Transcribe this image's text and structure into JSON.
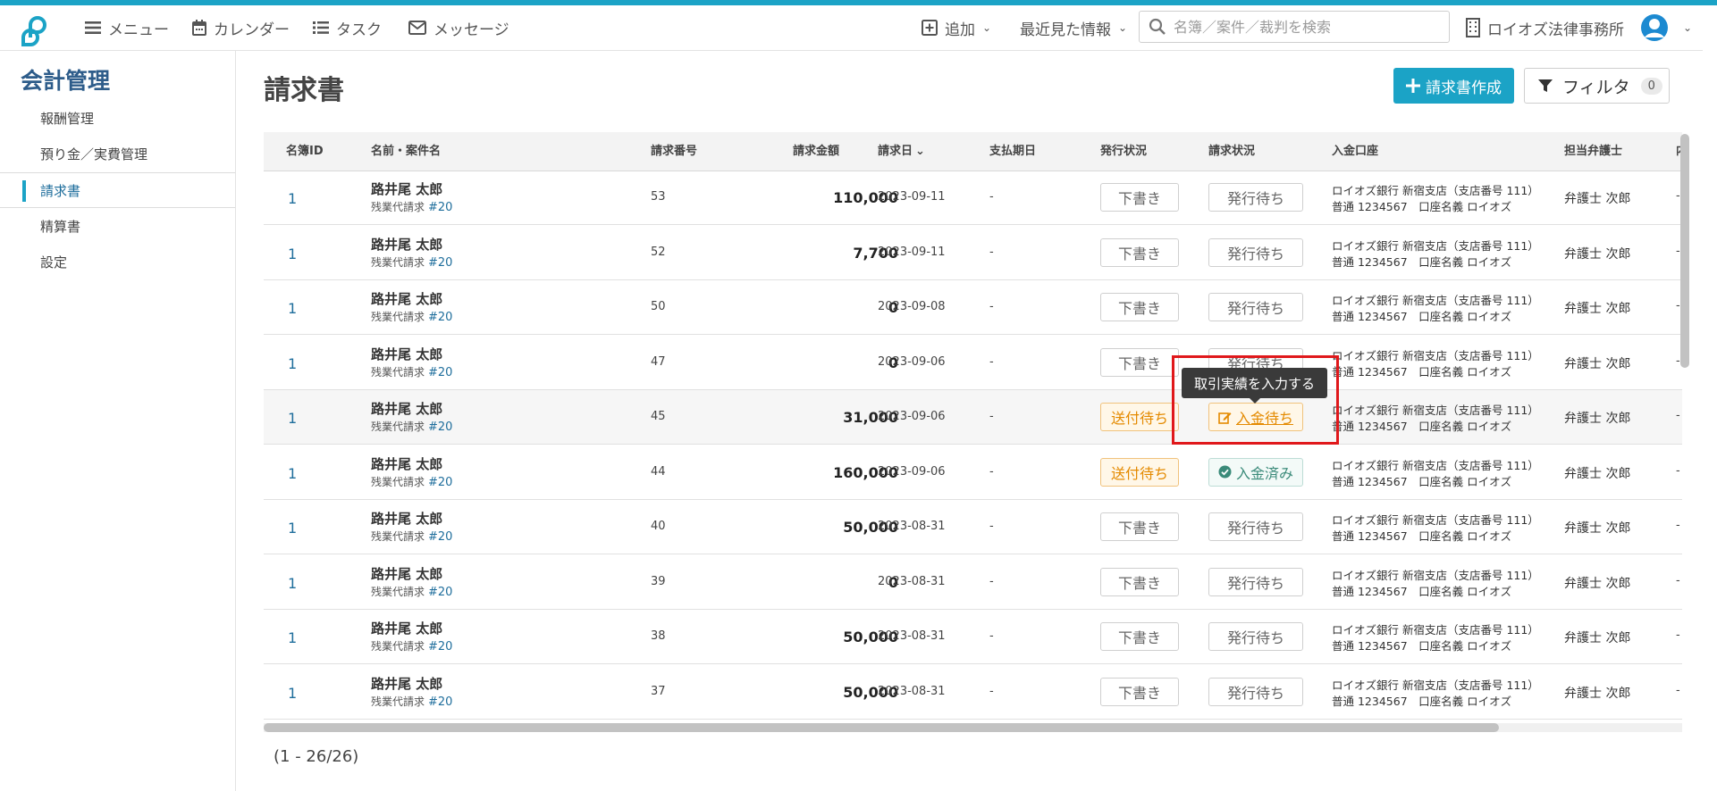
{
  "topbar": {
    "menu": "メニュー",
    "calendar": "カレンダー",
    "task": "タスク",
    "message": "メッセージ",
    "add": "追加",
    "recent": "最近見た情報",
    "search_placeholder": "名簿／案件／裁判を検索",
    "office": "ロイオズ法律事務所"
  },
  "sidebar": {
    "title": "会計管理",
    "items": [
      {
        "label": "報酬管理"
      },
      {
        "label": "預り金／実費管理"
      },
      {
        "label": "請求書"
      },
      {
        "label": "精算書"
      },
      {
        "label": "設定"
      }
    ]
  },
  "page": {
    "title": "請求書",
    "create_button": "請求書作成",
    "filter_button": "フィルタ",
    "filter_count": "0"
  },
  "table": {
    "headers": {
      "id": "名簿ID",
      "name": "名前・案件名",
      "number": "請求番号",
      "amount": "請求金額",
      "date": "請求日",
      "due": "支払期日",
      "issue": "発行状況",
      "status": "請求状況",
      "bank": "入金口座",
      "lawyer": "担当弁護士",
      "extra": "内"
    },
    "rows": [
      {
        "id": "1",
        "name": "路井尾 太郎",
        "case": "残業代請求",
        "ref": "#20",
        "number": "53",
        "amount": "110,000",
        "date": "2023-09-11",
        "due": "-",
        "issue": "下書き",
        "status": "発行待ち",
        "bank1": "ロイオズ銀行 新宿支店（支店番号 111）",
        "bank2": "普通 1234567　口座名義 ロイオズ",
        "lawyer": "弁護士 次郎",
        "extra": "-"
      },
      {
        "id": "1",
        "name": "路井尾 太郎",
        "case": "残業代請求",
        "ref": "#20",
        "number": "52",
        "amount": "7,700",
        "date": "2023-09-11",
        "due": "-",
        "issue": "下書き",
        "status": "発行待ち",
        "bank1": "ロイオズ銀行 新宿支店（支店番号 111）",
        "bank2": "普通 1234567　口座名義 ロイオズ",
        "lawyer": "弁護士 次郎",
        "extra": "-"
      },
      {
        "id": "1",
        "name": "路井尾 太郎",
        "case": "残業代請求",
        "ref": "#20",
        "number": "50",
        "amount": "0",
        "date": "2023-09-08",
        "due": "-",
        "issue": "下書き",
        "status": "発行待ち",
        "bank1": "ロイオズ銀行 新宿支店（支店番号 111）",
        "bank2": "普通 1234567　口座名義 ロイオズ",
        "lawyer": "弁護士 次郎",
        "extra": "-"
      },
      {
        "id": "1",
        "name": "路井尾 太郎",
        "case": "残業代請求",
        "ref": "#20",
        "number": "47",
        "amount": "0",
        "date": "2023-09-06",
        "due": "-",
        "issue": "下書き",
        "status": "発行待ち",
        "bank1": "ロイオズ銀行 新宿支店（支店番号 111）",
        "bank2": "普通 1234567　口座名義 ロイオズ",
        "lawyer": "弁護士 次郎",
        "extra": "-"
      },
      {
        "id": "1",
        "name": "路井尾 太郎",
        "case": "残業代請求",
        "ref": "#20",
        "number": "45",
        "amount": "31,000",
        "date": "2023-09-06",
        "due": "-",
        "issue": "送付待ち",
        "status": "入金待ち",
        "bank1": "ロイオズ銀行 新宿支店（支店番号 111）",
        "bank2": "普通 1234567　口座名義 ロイオズ",
        "lawyer": "弁護士 次郎",
        "extra": "-"
      },
      {
        "id": "1",
        "name": "路井尾 太郎",
        "case": "残業代請求",
        "ref": "#20",
        "number": "44",
        "amount": "160,000",
        "date": "2023-09-06",
        "due": "-",
        "issue": "送付待ち",
        "status": "入金済み",
        "bank1": "ロイオズ銀行 新宿支店（支店番号 111）",
        "bank2": "普通 1234567　口座名義 ロイオズ",
        "lawyer": "弁護士 次郎",
        "extra": "-"
      },
      {
        "id": "1",
        "name": "路井尾 太郎",
        "case": "残業代請求",
        "ref": "#20",
        "number": "40",
        "amount": "50,000",
        "date": "2023-08-31",
        "due": "-",
        "issue": "下書き",
        "status": "発行待ち",
        "bank1": "ロイオズ銀行 新宿支店（支店番号 111）",
        "bank2": "普通 1234567　口座名義 ロイオズ",
        "lawyer": "弁護士 次郎",
        "extra": "-"
      },
      {
        "id": "1",
        "name": "路井尾 太郎",
        "case": "残業代請求",
        "ref": "#20",
        "number": "39",
        "amount": "0",
        "date": "2023-08-31",
        "due": "-",
        "issue": "下書き",
        "status": "発行待ち",
        "bank1": "ロイオズ銀行 新宿支店（支店番号 111）",
        "bank2": "普通 1234567　口座名義 ロイオズ",
        "lawyer": "弁護士 次郎",
        "extra": "-"
      },
      {
        "id": "1",
        "name": "路井尾 太郎",
        "case": "残業代請求",
        "ref": "#20",
        "number": "38",
        "amount": "50,000",
        "date": "2023-08-31",
        "due": "-",
        "issue": "下書き",
        "status": "発行待ち",
        "bank1": "ロイオズ銀行 新宿支店（支店番号 111）",
        "bank2": "普通 1234567　口座名義 ロイオズ",
        "lawyer": "弁護士 次郎",
        "extra": "-"
      },
      {
        "id": "1",
        "name": "路井尾 太郎",
        "case": "残業代請求",
        "ref": "#20",
        "number": "37",
        "amount": "50,000",
        "date": "2023-08-31",
        "due": "-",
        "issue": "下書き",
        "status": "発行待ち",
        "bank1": "ロイオズ銀行 新宿支店（支店番号 111）",
        "bank2": "普通 1234567　口座名義 ロイオズ",
        "lawyer": "弁護士 次郎",
        "extra": "-"
      }
    ]
  },
  "tooltip": "取引実績を入力する",
  "pager": "(1 - 26/26)",
  "colors": {
    "accent": "#1ba3c6",
    "title": "#2d5c8a",
    "highlight": "#e0181b",
    "orange": "#e48a00",
    "green": "#3a8a79"
  }
}
